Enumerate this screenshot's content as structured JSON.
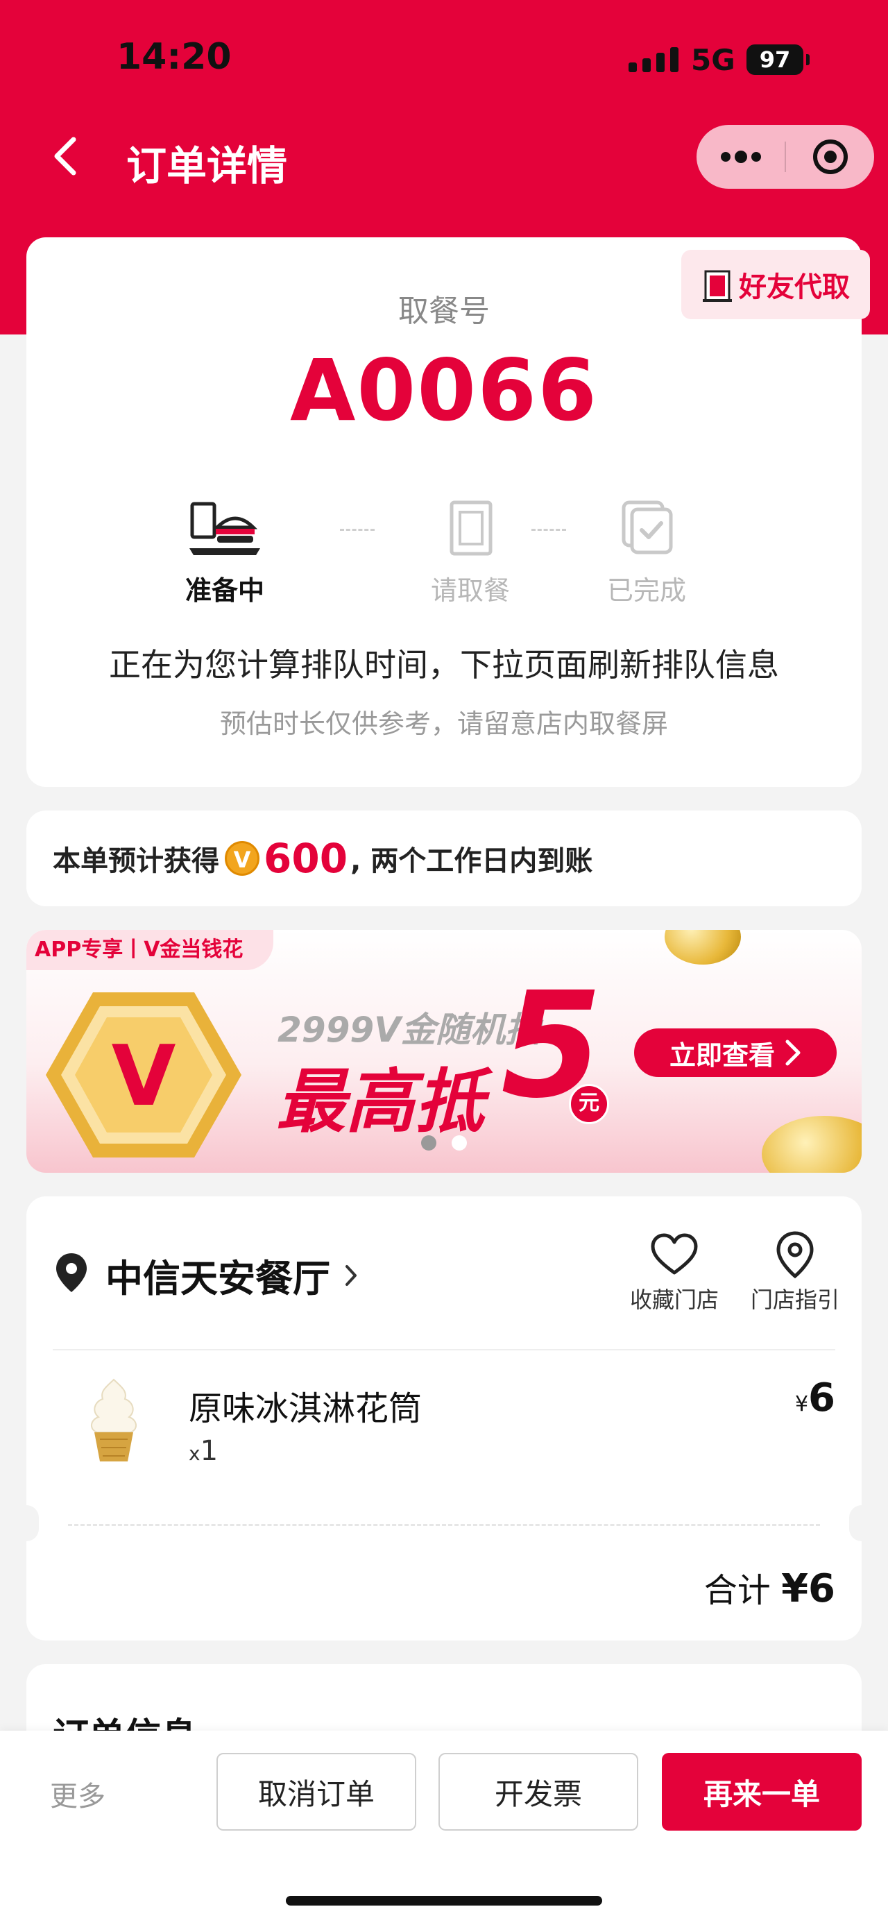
{
  "status_bar": {
    "time": "14:20",
    "network": "5G",
    "battery": "97"
  },
  "navbar": {
    "title": "订单详情",
    "back_icon": "chevron-left-icon",
    "more_icon": "more-dots-icon",
    "close_icon": "target-icon"
  },
  "pickup": {
    "friend_pickup_label": "好友代取",
    "label": "取餐号",
    "number": "A0066",
    "steps": [
      {
        "label": "准备中",
        "icon": "burger-tray-icon",
        "active": true
      },
      {
        "label": "请取餐",
        "icon": "kfc-bag-icon",
        "active": false
      },
      {
        "label": "已完成",
        "icon": "done-check-icon",
        "active": false
      }
    ],
    "queue_info": "正在为您计算排队时间，下拉页面刷新排队信息",
    "queue_note": "预估时长仅供参考，请留意店内取餐屏"
  },
  "points": {
    "prefix": "本单预计获得",
    "coin_letter": "V",
    "amount": "600",
    "suffix": ", 两个工作日内到账"
  },
  "banner": {
    "tag": "APP专享丨V金当钱花",
    "subtitle": "2999V金随机抽",
    "main": "最高抵",
    "big_number": "5",
    "unit": "元",
    "cta": "立即查看",
    "hex_letter": "V",
    "slides": 2,
    "active_slide": 0
  },
  "store": {
    "name": "中信天安餐厅",
    "favorite_label": "收藏门店",
    "guide_label": "门店指引",
    "items": [
      {
        "name": "原味冰淇淋花筒",
        "qty_prefix": "x",
        "qty": "1",
        "currency": "¥",
        "price": "6"
      }
    ],
    "total_label": "合计",
    "total_currency": "¥",
    "total": "6"
  },
  "order_info": {
    "title": "订单信息"
  },
  "bottom": {
    "more": "更多",
    "cancel": "取消订单",
    "invoice": "开发票",
    "reorder": "再来一单"
  },
  "colors": {
    "brand_red": "#e4023a",
    "background": "#f3f3f3",
    "coin_gold": "#f2a51e"
  }
}
